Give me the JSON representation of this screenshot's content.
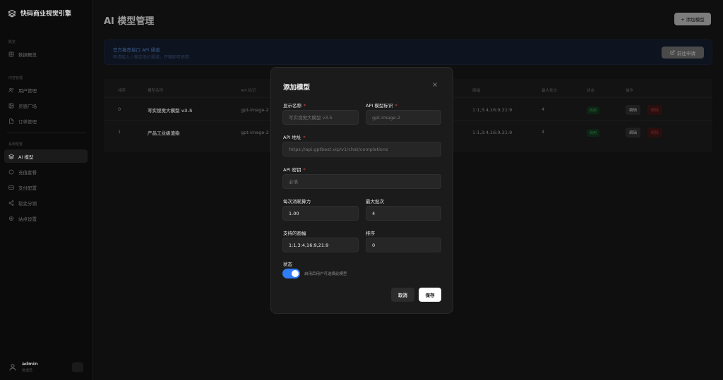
{
  "brand": {
    "name": "快码商业视觉引擎",
    "icon": "layers-icon"
  },
  "sidebar": {
    "sections": [
      {
        "label": "概览",
        "items": [
          {
            "label": "数据概览",
            "icon": "grid-icon",
            "active": false
          }
        ]
      },
      {
        "label": "内容管理",
        "items": [
          {
            "label": "用户管理",
            "icon": "users-icon",
            "active": false
          },
          {
            "label": "灵感广场",
            "icon": "image-icon",
            "active": false
          },
          {
            "label": "订单管理",
            "icon": "file-icon",
            "active": false
          }
        ]
      },
      {
        "label": "系统配置",
        "items": [
          {
            "label": "AI 模型",
            "icon": "layers-icon",
            "active": true
          },
          {
            "label": "充值套餐",
            "icon": "circle-icon",
            "active": false
          },
          {
            "label": "支付配置",
            "icon": "card-icon",
            "active": false
          },
          {
            "label": "裂变分销",
            "icon": "share-icon",
            "active": false
          },
          {
            "label": "站点设置",
            "icon": "gear-icon",
            "active": false
          }
        ]
      }
    ],
    "user": {
      "name": "admin",
      "role": "管理员"
    }
  },
  "main": {
    "title": "AI 模型管理",
    "add_button": "+ 添加模型",
    "banner": {
      "title": "官方推荐接口 API 通道",
      "subtitle": "申请接入 / 稳定低价渠道，开箱即可使用",
      "apply_button": "前往申请"
    },
    "table": {
      "headers": [
        "排序",
        "模型名称",
        "API 标识",
        "画幅",
        "最大批次",
        "状态",
        "操作"
      ],
      "rows": [
        {
          "sort": "0",
          "name": "写实视觉大模型 v3.5",
          "api": "gpt-image-2",
          "ratio": "1:1,3:4,16:9,21:9",
          "batch": "4",
          "status": "启用",
          "edit": "编辑",
          "delete": "删除"
        },
        {
          "sort": "1",
          "name": "产品工业级渲染",
          "api": "gpt-image-2",
          "ratio": "1:1,3:4,16:9,21:9",
          "batch": "4",
          "status": "启用",
          "edit": "编辑",
          "delete": "删除"
        }
      ]
    }
  },
  "modal": {
    "title": "添加模型",
    "fields": {
      "display_name": {
        "label": "显示名称",
        "placeholder": "写实视觉大模型 v3.5",
        "value": ""
      },
      "api_model_id": {
        "label": "API 模型标识",
        "placeholder": "gpt-image-2",
        "value": ""
      },
      "api_url": {
        "label": "API 地址",
        "placeholder": "https://api.gptbest.vip/v1/chat/completions",
        "value": ""
      },
      "api_key": {
        "label": "API 密钥",
        "placeholder": "必填",
        "value": ""
      },
      "cost": {
        "label": "每次消耗算力",
        "value": "1.00"
      },
      "max_batch": {
        "label": "最大批次",
        "value": "4"
      },
      "ratios": {
        "label": "支持的画幅",
        "value": "1:1,3:4,16:9,21:9"
      },
      "sort": {
        "label": "排序",
        "value": "0"
      }
    },
    "status": {
      "label": "状态",
      "description": "启用后用户可选择此模型",
      "enabled": true
    },
    "cancel_label": "取消",
    "save_label": "保存"
  },
  "colors": {
    "accent": "#2f7cf6",
    "required": "#e5484d",
    "danger": "#e5484d",
    "success": "#2fa84f"
  }
}
